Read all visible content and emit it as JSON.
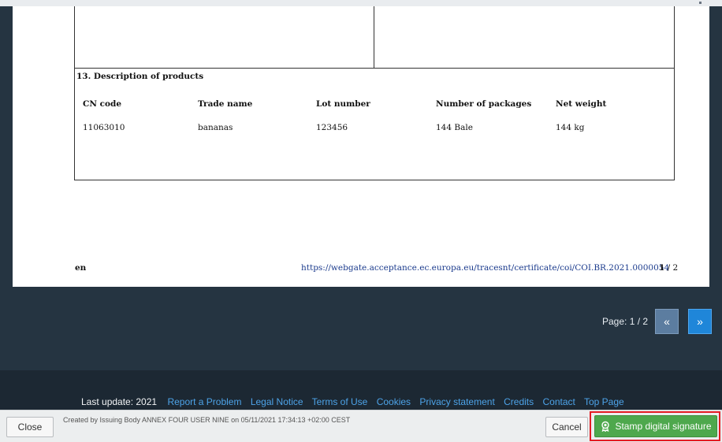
{
  "document": {
    "section_title": "13. Description of products",
    "columns": [
      "CN code",
      "Trade name",
      "Lot number",
      "Number of packages",
      "Net weight"
    ],
    "row": [
      "11063010",
      "bananas",
      "123456",
      "144 Bale",
      "144 kg"
    ],
    "footer": {
      "language": "en",
      "url": "https://webgate.acceptance.ec.europa.eu/tracesnt/certificate/coi/COI.BR.2021.0000054",
      "page_current": "1",
      "page_total": "/ 2"
    }
  },
  "pager": {
    "label": "Page: 1 / 2",
    "prev_icon": "double-chevron-left-icon",
    "next_icon": "double-chevron-right-icon",
    "prev_symbol": "«",
    "next_symbol": "»"
  },
  "links_bar": {
    "last_update": "Last update: 2021",
    "links": [
      "Report a Problem",
      "Legal Notice",
      "Terms of Use",
      "Cookies",
      "Privacy statement",
      "Credits",
      "Contact",
      "Top Page"
    ]
  },
  "action_bar": {
    "close_label": "Close",
    "created_text": "Created by Issuing Body ANNEX FOUR USER NINE on 05/11/2021 17:34:13 +02:00 CEST",
    "cancel_label": "Cancel",
    "stamp_label": "Stamp digital signature",
    "stamp_icon": "seal-icon"
  },
  "colors": {
    "background": "#253441",
    "link": "#4da3e8",
    "primary_button": "#1f86d9",
    "stamp_button": "#4ea84d",
    "highlight": "#e31b23"
  }
}
